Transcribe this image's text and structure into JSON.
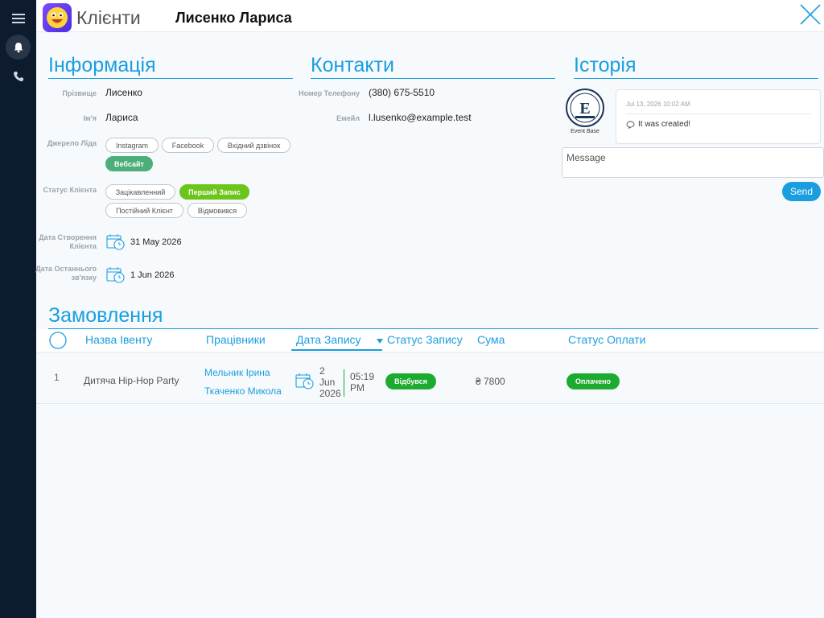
{
  "sidebar": {
    "icons": [
      "menu-icon",
      "bell-icon",
      "phone-icon"
    ]
  },
  "header": {
    "module_title": "Клієнти",
    "client_name": "Лисенко Лариса"
  },
  "info": {
    "title": "Інформація",
    "surname_label": "Прізвище",
    "surname": "Лисенко",
    "name_label": "Ім'я",
    "name": "Лариса",
    "lead_source_label": "Джерело Ліда",
    "lead_sources": [
      "Instagram",
      "Facebook",
      "Вхідний дзвінок",
      "Вебсайт"
    ],
    "status_label": "Статус Клієнта",
    "statuses": [
      "Зацікавленний",
      "Перший Запис",
      "Постійний Клієнт",
      "Відмовився"
    ],
    "created_label_1": "Дата Створення",
    "created_label_2": "Клієнта",
    "created_date": "31 May 2026",
    "last_contact_label_1": "Дата Останнього",
    "last_contact_label_2": "зв'язку",
    "last_contact_date": "1 Jun 2026"
  },
  "contacts": {
    "title": "Контакти",
    "phone_label": "Номер Телефону",
    "phone": "(380) 675-5510",
    "email_label": "Емейл",
    "email": "l.lusenko@example.test"
  },
  "history": {
    "title": "Історія",
    "avatar_caption": "Event Base",
    "entry_time": "Jul 13, 2026 10:02 AM",
    "entry_text": "It was created!",
    "message_placeholder": "Message",
    "send_label": "Send"
  },
  "orders": {
    "title": "Замовлення",
    "columns": [
      "Назва Івенту",
      "Працівники",
      "Дата Запису",
      "Статус Запису",
      "Сума",
      "Статус Оплати"
    ],
    "rows": [
      {
        "index": "1",
        "event": "Дитяча Hip-Hop Party",
        "staff": [
          "Мельник Ірина",
          "Ткаченко Микола"
        ],
        "day": "2",
        "month": "Jun",
        "year": "2026",
        "time_h": "05:19",
        "time_ap": "PM",
        "status": "Відбувся",
        "amount": "₴ 7800",
        "payment": "Оплачено"
      }
    ]
  },
  "colors": {
    "accent": "#1a9ee0",
    "sidebar": "#0d1b2e",
    "success": "#1cab2e",
    "lime": "#6cc51a",
    "lead_active": "#4caf7a"
  }
}
